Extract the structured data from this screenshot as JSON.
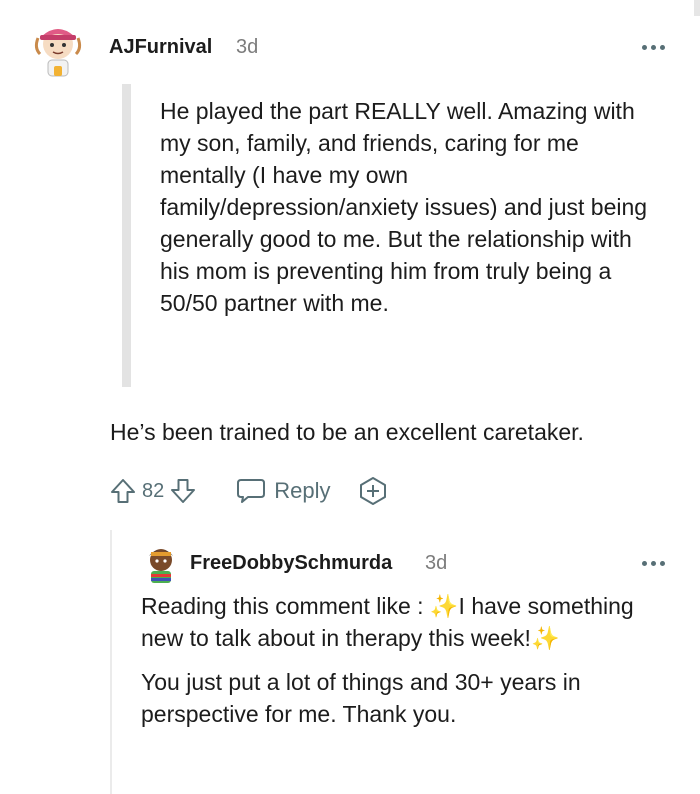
{
  "comment": {
    "author": "AJFurnival",
    "time": "3d",
    "quote": "He played the part REALLY well. Amazing with my son, family, and friends, caring for me mentally (I have my own family/depression/anxiety issues) and just being generally good to me. But the relationship with his mom is preventing him from truly being a 50/50 partner with me.",
    "body": "He’s been trained to be an excellent caretaker.",
    "score": "82",
    "reply_label": "Reply"
  },
  "reply": {
    "author": "FreeDobbySchmurda",
    "time": "3d",
    "para1_a": "Reading this comment like : ",
    "para1_b": "I have something new to talk about in therapy this week!",
    "para2": "You just put a lot of things and 30+ years in perspective for me. Thank you."
  },
  "icons": {
    "upvote": "arrow-up-icon",
    "downvote": "arrow-down-icon",
    "reply": "speech-bubble-icon",
    "award": "award-plus-icon",
    "more": "ellipsis-icon",
    "sparkles": "sparkles-emoji"
  },
  "colors": {
    "muted": "#576f76",
    "time": "#7c7c7c",
    "quote_bar": "#e3e3e3",
    "sparkle": "#f5c518"
  }
}
